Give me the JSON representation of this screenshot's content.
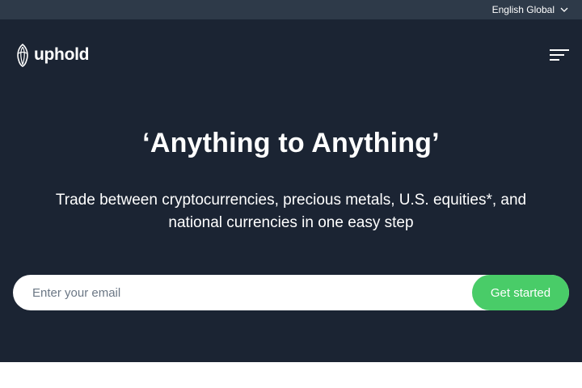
{
  "topbar": {
    "language_label": "English Global",
    "language_icon": "chevron-down-icon"
  },
  "header": {
    "logo_text": "uphold",
    "logo_icon": "uphold-logo-icon",
    "menu_icon": "hamburger-menu-icon"
  },
  "hero": {
    "headline": "‘Anything to Anything’",
    "subtitle": "Trade between cryptocurrencies, precious metals, U.S. equities*, and national currencies in one easy step"
  },
  "signup": {
    "email_placeholder": "Enter your email",
    "email_value": "",
    "button_label": "Get started"
  },
  "colors": {
    "background": "#1b2433",
    "topbar": "#2e3a49",
    "accent": "#49cc68",
    "text": "#ffffff"
  }
}
